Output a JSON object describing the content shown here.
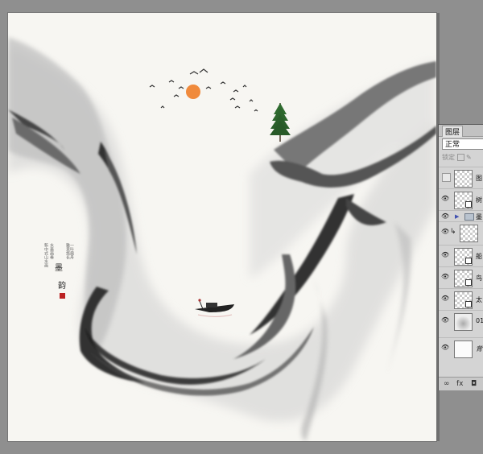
{
  "document": {
    "side_text": {
      "title_char_1": "墨",
      "title_char_2": "韵",
      "columns": [
        "新中式山水画",
        "水墨画卷",
        "雅意悠长",
        "一叶扁舟",
        "日出东方",
        "江山如画"
      ]
    }
  },
  "layers_panel": {
    "tab_label": "图层",
    "blend_mode": "正常",
    "lock_label": "锁定",
    "layers": [
      {
        "name": "图",
        "visible": false,
        "thumb": "transparent",
        "smart": false
      },
      {
        "name": "树",
        "visible": true,
        "thumb": "transparent",
        "smart": true
      },
      {
        "name": "墨",
        "visible": true,
        "thumb": "group",
        "smart": false,
        "group": true
      },
      {
        "name": "",
        "visible": true,
        "thumb": "transparent",
        "smart": false,
        "clipped": true
      },
      {
        "name": "船",
        "visible": true,
        "thumb": "transparent",
        "smart": true
      },
      {
        "name": "鸟",
        "visible": true,
        "thumb": "transparent",
        "smart": true
      },
      {
        "name": "太",
        "visible": true,
        "thumb": "transparent",
        "smart": true
      },
      {
        "name": "01",
        "visible": true,
        "thumb": "ink",
        "smart": false
      },
      {
        "name": "背",
        "visible": true,
        "thumb": "plain",
        "smart": false
      }
    ],
    "bottom_icons": [
      "link-icon",
      "fx-icon",
      "mask-icon"
    ]
  }
}
